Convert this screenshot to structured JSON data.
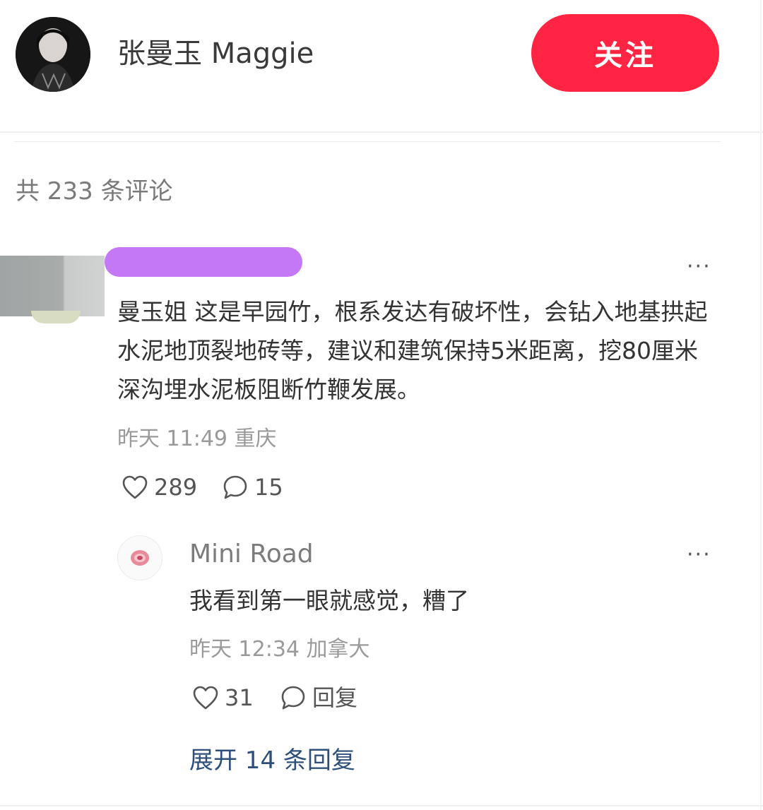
{
  "author": {
    "name": "张曼玉 Maggie",
    "follow_label": "关注"
  },
  "comments_header": {
    "count_label": "共 233 条评论"
  },
  "comment": {
    "text": "曼玉姐 这是早园竹，根系发达有破坏性，会钻入地基拱起水泥地顶裂地砖等，建议和建筑保持5米距离，挖80厘米深沟埋水泥板阻断竹鞭发展。",
    "meta": "昨天 11:49 重庆",
    "likes": "289",
    "replies": "15",
    "more_label": "···"
  },
  "reply": {
    "name": "Mini Road",
    "text": "我看到第一眼就感觉，糟了",
    "meta": "昨天 12:34 加拿大",
    "likes": "31",
    "reply_label": "回复",
    "more_label": "···"
  },
  "expand": {
    "label": "展开 14 条回复"
  },
  "icons": {
    "like": "heart-outline-icon",
    "comment": "speech-bubble-icon",
    "more": "ellipsis-icon"
  },
  "colors": {
    "follow_button": "#ff2442",
    "link": "#2e4f7a",
    "redaction": "#c578f5"
  }
}
